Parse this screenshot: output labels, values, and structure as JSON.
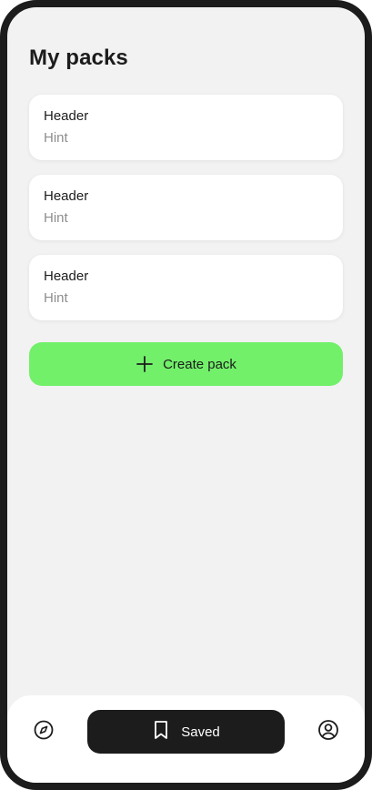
{
  "page": {
    "title": "My packs"
  },
  "packs": [
    {
      "header": "Header",
      "hint": "Hint"
    },
    {
      "header": "Header",
      "hint": "Hint"
    },
    {
      "header": "Header",
      "hint": "Hint"
    }
  ],
  "actions": {
    "create_label": "Create pack",
    "create_icon": "plus-icon"
  },
  "bottom_nav": {
    "items": [
      {
        "id": "explore",
        "icon": "compass-icon",
        "label": "",
        "active": false
      },
      {
        "id": "saved",
        "icon": "bookmark-icon",
        "label": "Saved",
        "active": true
      },
      {
        "id": "profile",
        "icon": "user-circle-icon",
        "label": "",
        "active": false
      }
    ]
  },
  "colors": {
    "background": "#f2f2f2",
    "frame": "#1c1c1c",
    "card": "#ffffff",
    "accent": "#72f06a",
    "hint_text": "#8d8d8d",
    "active_nav": "#1c1c1c"
  }
}
